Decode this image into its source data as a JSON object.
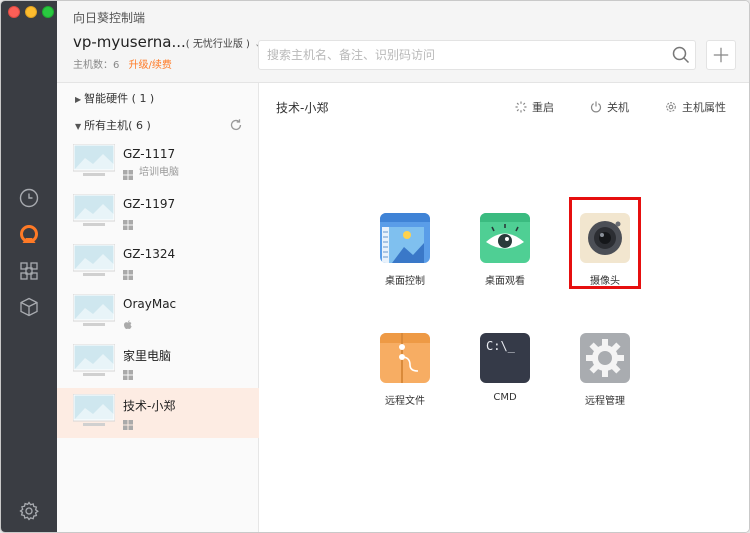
{
  "app": {
    "title": "向日葵控制端"
  },
  "account": {
    "name": "vp-myuserna...",
    "edition": "( 无忧行业版 )",
    "host_count_label": "主机数：",
    "host_count": "6",
    "upgrade_label": "升级/续费"
  },
  "search": {
    "placeholder": "搜索主机名、备注、识别码访问"
  },
  "sidebar": {
    "groups": [
      {
        "label": "智能硬件 ( 1 )"
      },
      {
        "label": "所有主机( 6 )"
      }
    ],
    "hosts": [
      {
        "name": "GZ-1117",
        "os": "windows-icon",
        "desc": "培训电脑"
      },
      {
        "name": "GZ-1197",
        "os": "windows-icon",
        "desc": ""
      },
      {
        "name": "GZ-1324",
        "os": "windows-icon",
        "desc": ""
      },
      {
        "name": "OrayMac",
        "os": "apple-icon",
        "desc": ""
      },
      {
        "name": "家里电脑",
        "os": "windows-icon",
        "desc": ""
      },
      {
        "name": "技术-小郑",
        "os": "windows-icon",
        "desc": "",
        "selected": true
      }
    ]
  },
  "main": {
    "host_title": "技术-小郑",
    "actions": [
      {
        "label": "重启",
        "icon": "restart-icon"
      },
      {
        "label": "关机",
        "icon": "power-icon"
      },
      {
        "label": "主机属性",
        "icon": "gear-icon"
      }
    ],
    "tiles": [
      {
        "label": "桌面控制",
        "icon": "desktop-control-icon"
      },
      {
        "label": "桌面观看",
        "icon": "desktop-view-eye-icon"
      },
      {
        "label": "摄像头",
        "icon": "camera-icon",
        "highlighted": true
      },
      {
        "label": "远程文件",
        "icon": "remote-file-icon"
      },
      {
        "label": "CMD",
        "icon": "cmd-terminal-icon",
        "glyph": "C:\\_"
      },
      {
        "label": "远程管理",
        "icon": "remote-manage-gear-icon"
      }
    ]
  },
  "colors": {
    "rail": "#3a3d43",
    "accent_orange": "#ff7a26",
    "selected_row": "#fdece3",
    "highlight_red": "#e60f0f"
  }
}
